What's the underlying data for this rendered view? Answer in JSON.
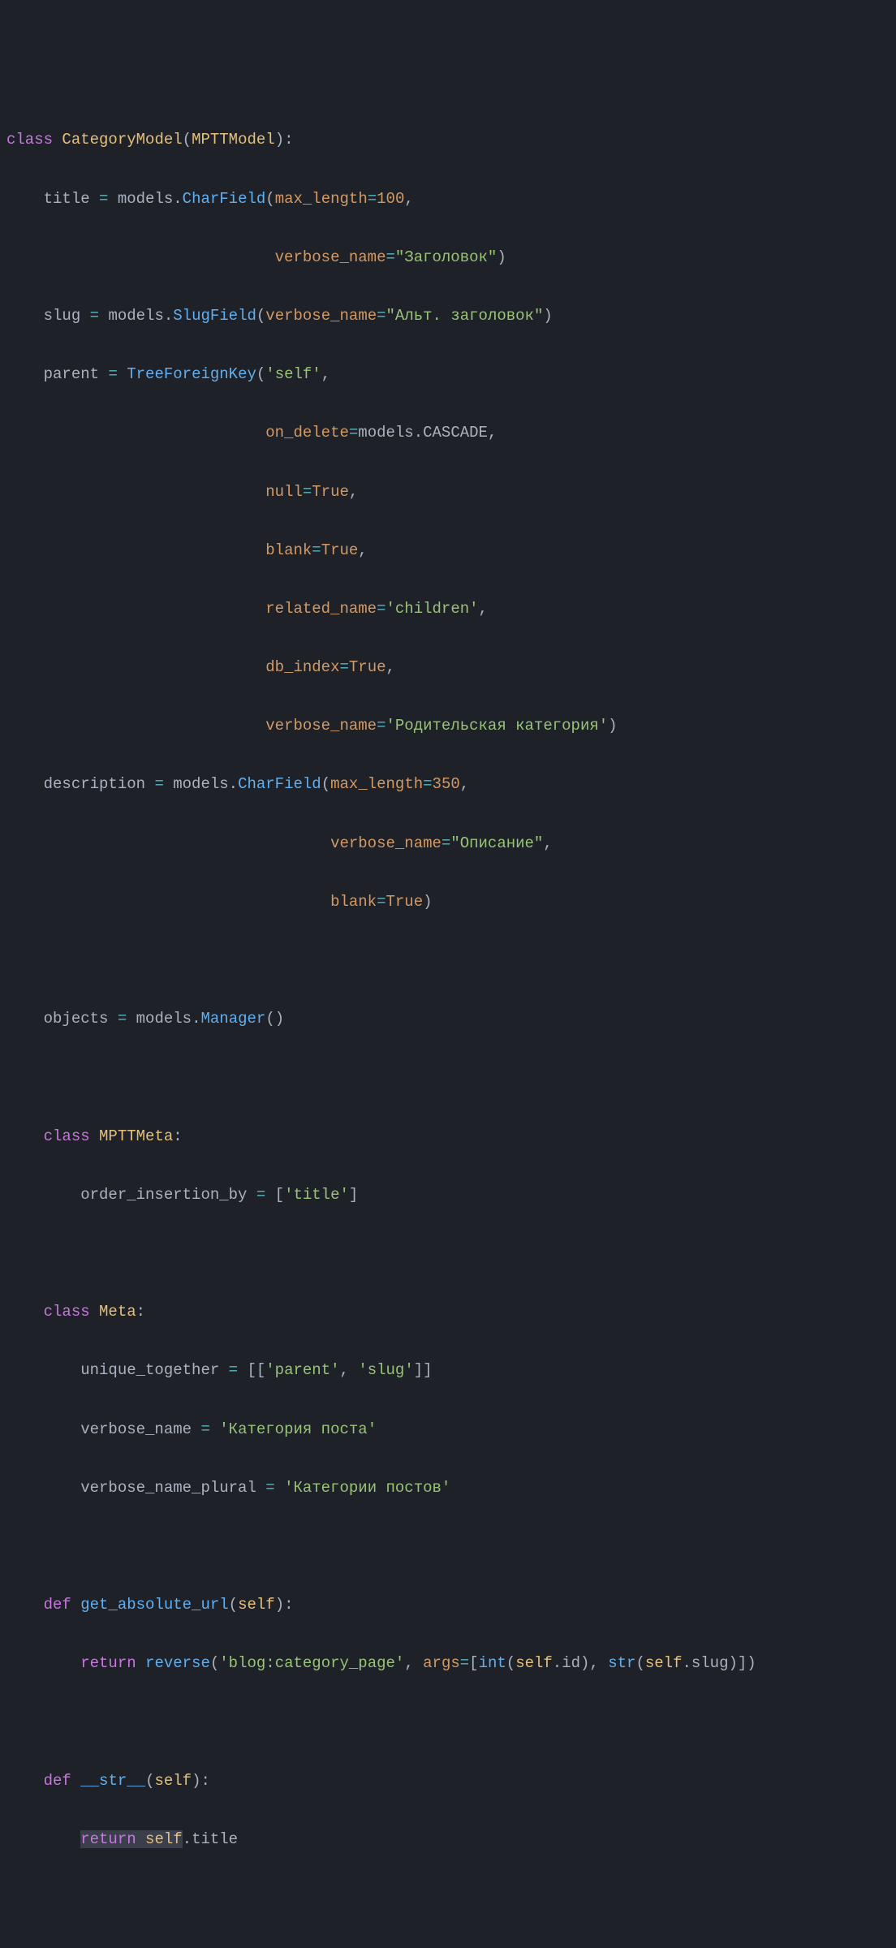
{
  "code": {
    "line1": {
      "kw1": "class",
      "cls1": "CategoryModel",
      "cls2": "MPTTModel"
    },
    "line2": {
      "id": "title",
      "op": "=",
      "mod": "models",
      "fn": "CharField",
      "p1": "max_length",
      "v1": "100"
    },
    "line3": {
      "p1": "verbose_name",
      "v1": "\"Заголовок\""
    },
    "line4": {
      "id": "slug",
      "op": "=",
      "mod": "models",
      "fn": "SlugField",
      "p1": "verbose_name",
      "v1": "\"Альт. заголовок\""
    },
    "line5": {
      "id": "parent",
      "op": "=",
      "fn": "TreeForeignKey",
      "v1": "'self'"
    },
    "line6": {
      "p1": "on_delete",
      "mod": "models",
      "v1": "CASCADE"
    },
    "line7": {
      "p1": "null",
      "v1": "True"
    },
    "line8": {
      "p1": "blank",
      "v1": "True"
    },
    "line9": {
      "p1": "related_name",
      "v1": "'children'"
    },
    "line10": {
      "p1": "db_index",
      "v1": "True"
    },
    "line11": {
      "p1": "verbose_name",
      "v1": "'Родительская категория'"
    },
    "line12": {
      "id": "description",
      "op": "=",
      "mod": "models",
      "fn": "CharField",
      "p1": "max_length",
      "v1": "350"
    },
    "line13": {
      "p1": "verbose_name",
      "v1": "\"Описание\""
    },
    "line14": {
      "p1": "blank",
      "v1": "True"
    },
    "line16": {
      "id": "objects",
      "op": "=",
      "mod": "models",
      "fn": "Manager"
    },
    "line18": {
      "kw": "class",
      "cls": "MPTTMeta"
    },
    "line19": {
      "id": "order_insertion_by",
      "op": "=",
      "v1": "'title'"
    },
    "line21": {
      "kw": "class",
      "cls": "Meta"
    },
    "line22": {
      "id": "unique_together",
      "op": "=",
      "v1": "'parent'",
      "v2": "'slug'"
    },
    "line23": {
      "id": "verbose_name",
      "op": "=",
      "v1": "'Категория поста'"
    },
    "line24": {
      "id": "verbose_name_plural",
      "op": "=",
      "v1": "'Категории постов'"
    },
    "line26": {
      "kw": "def",
      "fn": "get_absolute_url",
      "p1": "self"
    },
    "line27": {
      "kw": "return",
      "fn": "reverse",
      "v1": "'blog:category_page'",
      "p1": "args",
      "fn2": "int",
      "s1": "self",
      "a1": "id",
      "fn3": "str",
      "s2": "self",
      "a2": "slug"
    },
    "line29": {
      "kw": "def",
      "fn": "__str__",
      "p1": "self"
    },
    "line30": {
      "kw": "return",
      "s1": "self",
      "a1": "title"
    }
  }
}
